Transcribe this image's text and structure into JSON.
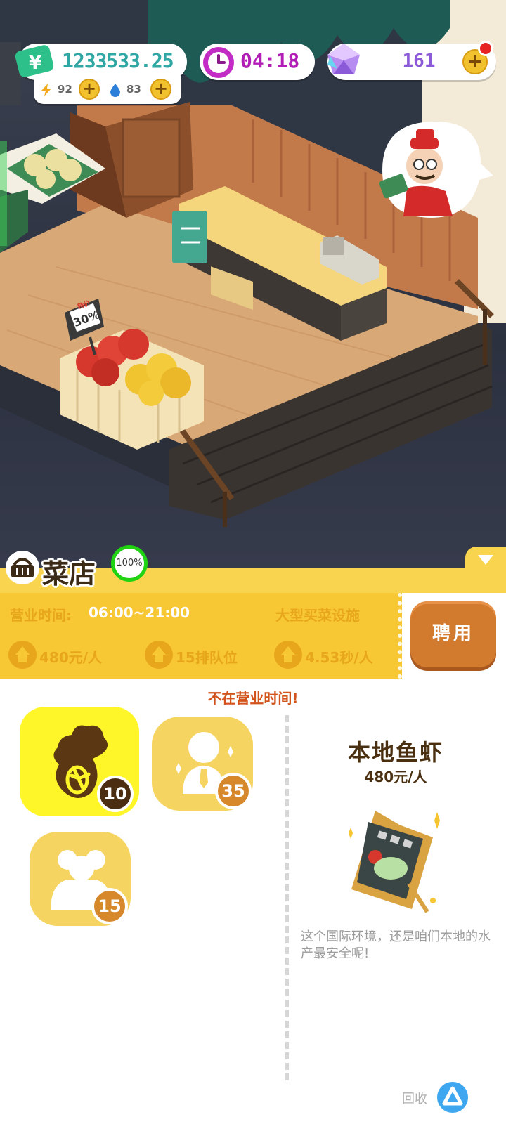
{
  "hud": {
    "money": "1233533.25",
    "energy": "92",
    "water": "83",
    "time": "04:18",
    "gems": "161"
  },
  "shop": {
    "title": "菜店",
    "progress": "100%",
    "hours_label": "营业时间:",
    "hours_value": "06:00~21:00",
    "facility": "大型买菜设施",
    "stats": [
      "480元/人",
      "15排队位",
      "4.53秒/人"
    ],
    "hire_label": "聘用",
    "notice": "不在营业时间!"
  },
  "upgrades": [
    {
      "icon": "vegetable-icon",
      "level": "10",
      "selected": true
    },
    {
      "icon": "staff-icon",
      "level": "35",
      "selected": false
    },
    {
      "icon": "queue-icon",
      "level": "15",
      "selected": false
    }
  ],
  "detail": {
    "title": "本地鱼虾",
    "price": "480元/人",
    "description": "这个国际环境，还是咱们本地的水产最安全呢!"
  },
  "recycle": {
    "label": "回收"
  },
  "scene": {
    "price_tag": "30%",
    "tag_header": "特价"
  },
  "colors": {
    "panel_yellow": "#f9d54f",
    "card_yellow": "#f8c734",
    "hire_orange": "#d27a2e",
    "money_teal": "#2fa7a4",
    "time_purple": "#b21fb6",
    "notice_red": "#d2541c"
  }
}
